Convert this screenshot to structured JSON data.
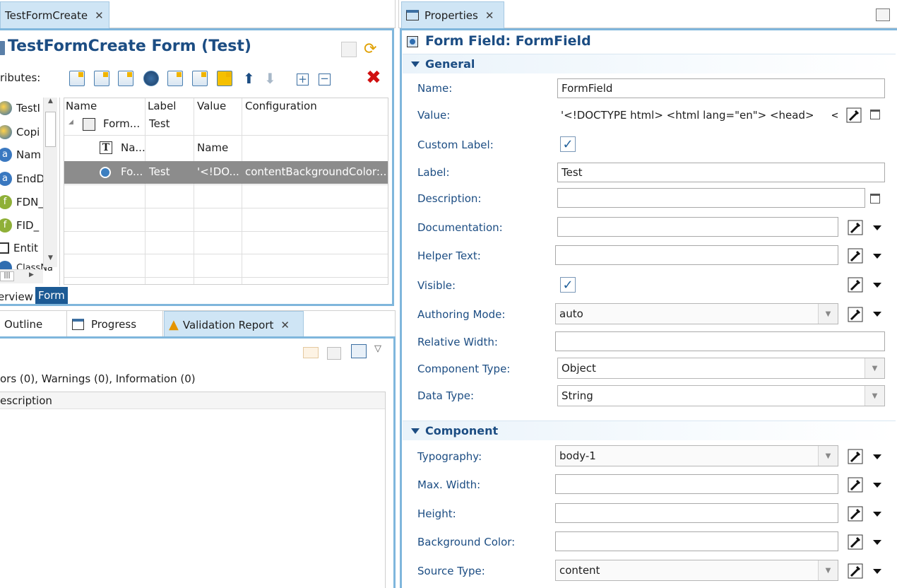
{
  "editor": {
    "tab_label": "TestFormCreate",
    "title": "TestFormCreate Form (Test)",
    "attributes_label": "ributes:",
    "attributes": [
      "TestI",
      "Copi",
      "Nam",
      "EndD",
      "FDN_",
      "FID_",
      "Entit",
      "ClassNa"
    ],
    "table": {
      "columns": [
        "Name",
        "Label",
        "Value",
        "Configuration"
      ],
      "rows": [
        {
          "name": "Form...",
          "label": "Test",
          "value": "",
          "config": ""
        },
        {
          "name": "Na...",
          "label": "",
          "value": "Name",
          "config": ""
        },
        {
          "name": "Fo...",
          "label": "Test",
          "value": "'<!DO...",
          "config": "contentBackgroundColor:..."
        }
      ]
    },
    "bottom_tabs": [
      "erview",
      "Form"
    ]
  },
  "lower": {
    "tabs": [
      "Outline",
      "Progress",
      "Validation Report"
    ],
    "summary": "ors (0), Warnings (0), Information (0)",
    "column_header": "escription"
  },
  "properties": {
    "tab_label": "Properties",
    "title": "Form Field: FormField",
    "general": {
      "header": "General",
      "name_label": "Name:",
      "name_value": "FormField",
      "value_label": "Value:",
      "value_value": "'<!DOCTYPE html> <html lang=\"en\"> <head>     <m",
      "custom_label_label": "Custom Label:",
      "label_label": "Label:",
      "label_value": "Test",
      "description_label": "Description:",
      "documentation_label": "Documentation:",
      "helper_text_label": "Helper Text:",
      "visible_label": "Visible:",
      "authoring_mode_label": "Authoring Mode:",
      "authoring_mode_value": "auto",
      "relative_width_label": "Relative Width:",
      "component_type_label": "Component Type:",
      "component_type_value": "Object",
      "data_type_label": "Data Type:",
      "data_type_value": "String"
    },
    "component": {
      "header": "Component",
      "typography_label": "Typography:",
      "typography_value": "body-1",
      "max_width_label": "Max. Width:",
      "height_label": "Height:",
      "background_color_label": "Background Color:",
      "source_type_label": "Source Type:",
      "source_type_value": "content"
    }
  }
}
